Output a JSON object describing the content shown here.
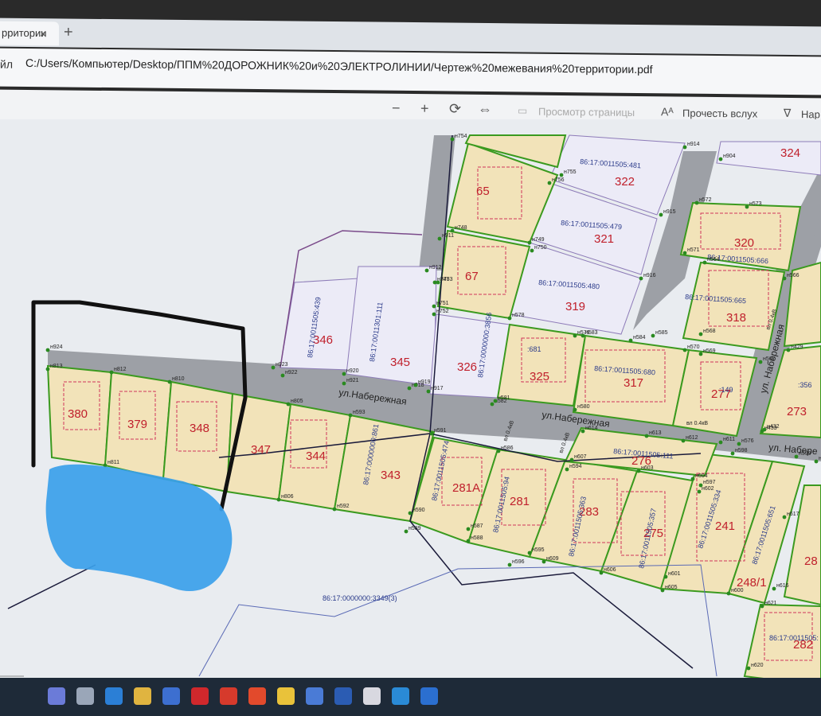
{
  "browser": {
    "tab_title": "рритории",
    "tab_close": "×",
    "new_tab": "+",
    "address_label": "йл",
    "url": "C:/Users/Компьютер/Desktop/ППМ%20ДОРОЖНИК%20и%20ЭЛЕКТРОЛИНИИ/Чертеж%20межевания%20территории.pdf"
  },
  "pdf_toolbar": {
    "zoom_out": "−",
    "zoom_in": "+",
    "rotate": "⟳",
    "fit": "⇔",
    "page_view": "Просмотр страницы",
    "read_aloud": "Прочесть вслух",
    "draw": "Нар"
  },
  "map": {
    "streets": [
      "ул.Набережная",
      "ул.Набережная",
      "ул. Набережная",
      "ул. Набере"
    ],
    "plots": [
      {
        "num": "380"
      },
      {
        "num": "379"
      },
      {
        "num": "348"
      },
      {
        "num": "347"
      },
      {
        "num": "344"
      },
      {
        "num": "343"
      },
      {
        "num": "281А"
      },
      {
        "num": "281"
      },
      {
        "num": "283"
      },
      {
        "num": "275"
      },
      {
        "num": "241"
      },
      {
        "num": "248/1"
      },
      {
        "num": "282"
      },
      {
        "num": "346"
      },
      {
        "num": "345"
      },
      {
        "num": "326"
      },
      {
        "num": "325"
      },
      {
        "num": "317"
      },
      {
        "num": "277"
      },
      {
        "num": "273"
      },
      {
        "num": "65"
      },
      {
        "num": "67"
      },
      {
        "num": "322"
      },
      {
        "num": "321"
      },
      {
        "num": "319"
      },
      {
        "num": "320"
      },
      {
        "num": "318"
      },
      {
        "num": "324"
      },
      {
        "num": "276"
      },
      {
        "num": "28"
      }
    ],
    "cadastral": [
      "86:17:0011505:481",
      "86:17:0011505:479",
      "86:17:0011505:480",
      "86:17:0011505:666",
      "86:17:0011505:665",
      "86:17:0011505:680",
      "86:17:0011505:111",
      "86:17:0011505:474",
      "86:17:0011505:94",
      "86:17:0011505:363",
      "86:17:0011505:357",
      "86:17:0011505:334",
      "86:17:0011505:651",
      "86:17:0000000:3349(3)",
      "86:17:0011505:439",
      "86:17:0011301:111",
      "86:17:0000000:3856",
      "86:17:0011505:",
      "86:17:0000000:861",
      ":681",
      ":356",
      ":149"
    ],
    "powerline_labels": [
      "вл 0.4кВ",
      "вл 0.4кВ",
      "вл 0.4кВ",
      "вл 0.4кВ"
    ],
    "nodes": [
      "н754",
      "н755",
      "н756",
      "н914",
      "н904",
      "н915",
      "н911",
      "н748",
      "н749",
      "н750",
      "н916",
      "н912",
      "н747",
      "н753",
      "н751",
      "н752",
      "н578",
      "н579",
      "н583",
      "н584",
      "н585",
      "н570",
      "н569",
      "н567",
      "н566",
      "н564",
      "н568",
      "н572",
      "н573",
      "н571",
      "н924",
      "н923",
      "н922",
      "н920",
      "н921",
      "н918",
      "н919",
      "н917",
      "н582",
      "н581",
      "н580",
      "н614",
      "н613",
      "н612",
      "н611",
      "н576",
      "н598",
      "н599",
      "н812",
      "н810",
      "н805",
      "н593",
      "н591",
      "н586",
      "н607",
      "н594",
      "н603",
      "н604",
      "н602",
      "н597",
      "н601",
      "н606",
      "н605",
      "н811",
      "н806",
      "н592",
      "н590",
      "н587",
      "н588",
      "н589",
      "н595",
      "н596",
      "н609",
      "н600",
      "н616",
      "н617",
      "н620",
      "н621",
      "н622",
      "н813",
      "н433",
      "н432",
      "н429"
    ]
  },
  "colors": {
    "plot_fill": "#f2e3b9",
    "plot_border": "#3b9a1f",
    "plot_number": "#c0202c",
    "road": "#9da0a6",
    "dashed_inner": "#d0345a",
    "cadastral_fill": "#ecebf7",
    "highlight_marker": "#111111",
    "blur_overlay": "#3aa0ea"
  },
  "taskbar": {
    "icons": [
      "search-icon",
      "task-view-icon",
      "edge-icon",
      "explorer-icon",
      "store-icon",
      "opera-icon",
      "yandex-icon",
      "yandex-browser-icon",
      "chrome-icon",
      "mail-icon",
      "word-icon",
      "files-icon",
      "app-icon",
      "media-player-icon"
    ]
  }
}
